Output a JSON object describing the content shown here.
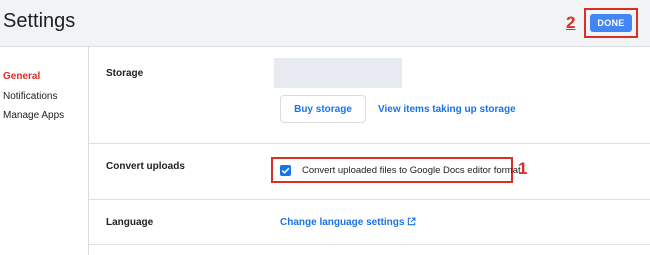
{
  "header": {
    "title": "Settings",
    "done_label": "DONE",
    "annotation_done": "2"
  },
  "sidebar": {
    "items": [
      {
        "label": "General",
        "active": true
      },
      {
        "label": "Notifications",
        "active": false
      },
      {
        "label": "Manage Apps",
        "active": false
      }
    ]
  },
  "storage": {
    "label": "Storage",
    "buy_label": "Buy storage",
    "view_link": "View items taking up storage"
  },
  "convert": {
    "label": "Convert uploads",
    "checkbox_label": "Convert uploaded files to Google Docs editor format",
    "checked": true,
    "annotation": "1"
  },
  "language": {
    "label": "Language",
    "link": "Change language settings",
    "link_icon": "external-link-icon"
  },
  "colors": {
    "accent": "#1a73e8",
    "done_button": "#4285f4",
    "annotation": "#d93025",
    "header_bg": "#f1f3f4"
  }
}
